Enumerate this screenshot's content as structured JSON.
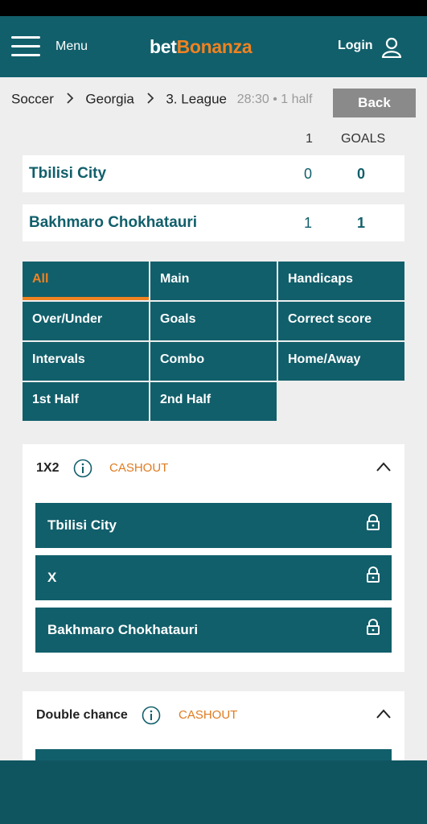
{
  "header": {
    "menu_label": "Menu",
    "logo_part1": "bet",
    "logo_part2": "Bonanza",
    "login_label": "Login"
  },
  "breadcrumb": {
    "sport": "Soccer",
    "country": "Georgia",
    "league": "3. League",
    "time": "28:30 • 1 half"
  },
  "back_label": "Back",
  "score_headers": {
    "period": "1",
    "goals": "GOALS"
  },
  "teams": [
    {
      "name": "Tbilisi City",
      "period": "0",
      "goals": "0"
    },
    {
      "name": "Bakhmaro Chokhatauri",
      "period": "1",
      "goals": "1"
    }
  ],
  "tabs": [
    "All",
    "Main",
    "Handicaps",
    "Over/Under",
    "Goals",
    "Correct score",
    "Intervals",
    "Combo",
    "Home/Away",
    "1st Half",
    "2nd Half"
  ],
  "markets": [
    {
      "title": "1X2",
      "badge": "CASHOUT",
      "outcomes": [
        "Tbilisi City",
        "X",
        "Bakhmaro Chokhatauri"
      ]
    },
    {
      "title": "Double chance",
      "badge": "CASHOUT"
    }
  ],
  "colors": {
    "primary": "#115f6b",
    "accent": "#f08220",
    "back_button": "#8a8a8a"
  }
}
